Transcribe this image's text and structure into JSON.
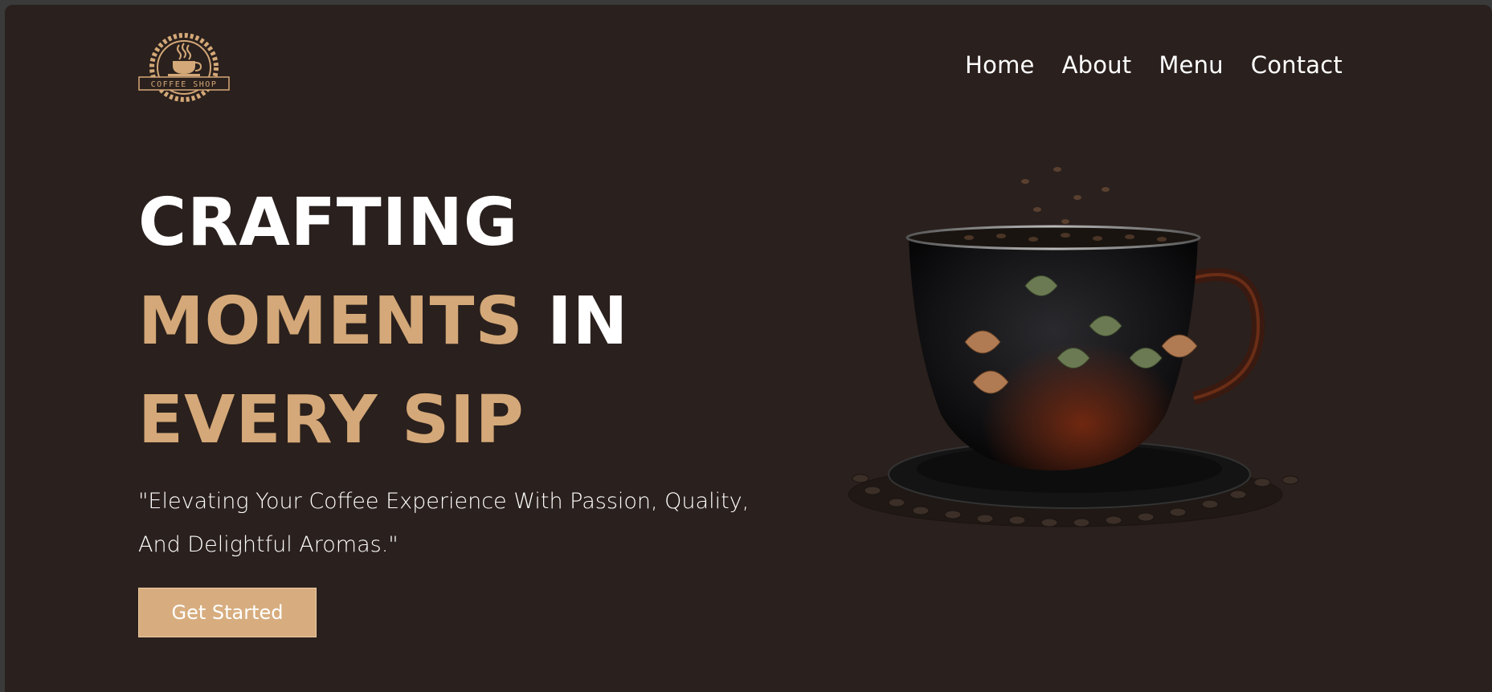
{
  "brand": {
    "logo_text": "COFFEE SHOP",
    "accent_color": "#d4a878",
    "background_color": "#2a201d"
  },
  "nav": {
    "items": [
      "Home",
      "About",
      "Menu",
      "Contact"
    ]
  },
  "hero": {
    "title_line1": "CRAFTING",
    "title_line2_accent": "MOMENTS",
    "title_line2_white": "IN",
    "title_line3": "EVERY SIP",
    "subtitle": "\"Elevating Your Coffee Experience With Passion, Quality, And Delightful Aromas.\"",
    "cta_label": "Get Started"
  },
  "icons": {
    "logo": "coffee-shop-logo-icon",
    "hero_image": "coffee-cup-illustration"
  }
}
